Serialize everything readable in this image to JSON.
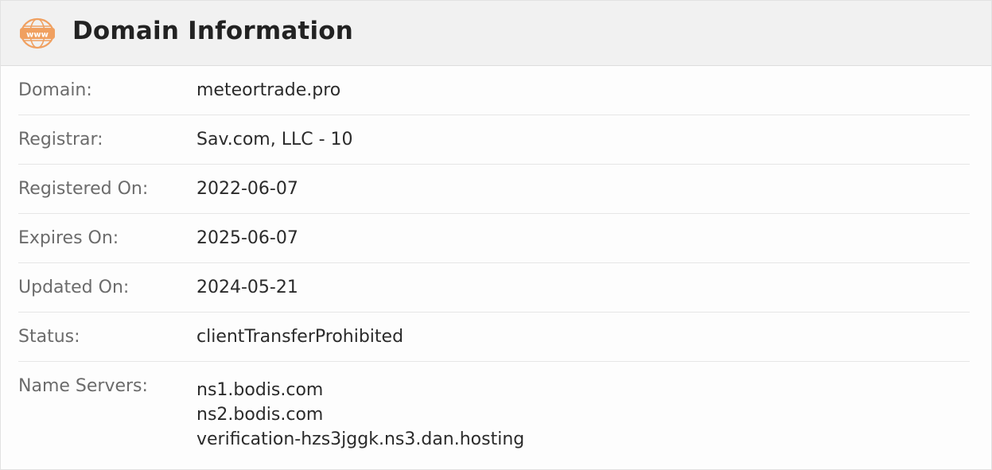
{
  "header": {
    "title": "Domain Information",
    "logo_text": "www",
    "accent_color": "#f0a060"
  },
  "rows": [
    {
      "label": "Domain:",
      "value": "meteortrade.pro"
    },
    {
      "label": "Registrar:",
      "value": "Sav.com, LLC - 10"
    },
    {
      "label": "Registered On:",
      "value": "2022-06-07"
    },
    {
      "label": "Expires On:",
      "value": "2025-06-07"
    },
    {
      "label": "Updated On:",
      "value": "2024-05-21"
    },
    {
      "label": "Status:",
      "value": "clientTransferProhibited"
    }
  ],
  "name_servers": {
    "label": "Name Servers:",
    "items": [
      "ns1.bodis.com",
      "ns2.bodis.com",
      "verification-hzs3jggk.ns3.dan.hosting"
    ]
  }
}
